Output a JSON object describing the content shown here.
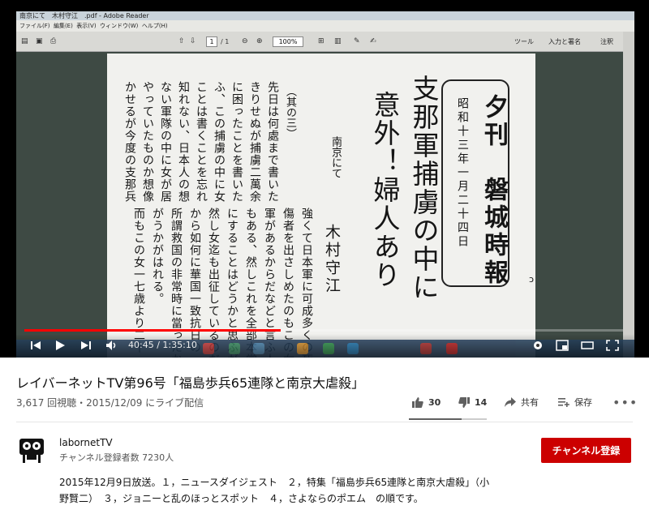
{
  "video": {
    "reader": {
      "window_title": "南京にて　木村守江　.pdf - Adobe Reader",
      "menu": [
        "ファイル(F)",
        "編集(E)",
        "表示(V)",
        "ウィンドウ(W)",
        "ヘルプ(H)"
      ],
      "page_current": "1",
      "page_total": "/ 1",
      "zoom": "100%",
      "tools_label": "ツール",
      "sign_label": "入力と署名",
      "comment_label": "注釈"
    },
    "document": {
      "masthead_title": "夕刊　磐城時報",
      "masthead_date": "昭和十三年一月二十四日",
      "headline_1": "支那軍捕虜の中に",
      "headline_2": "意外！婦人あり",
      "dateline": "南京にて",
      "author": "木村守江",
      "section_mark": "（其の三）",
      "body_right": [
        "先日は何處まで書いたかはっ",
        "きりせぬが捕虜二萬余の仕末",
        "に困ったことを書いたと思",
        "ふ、この捕虜の中に女が居た",
        "ことは書くことを忘れたかも",
        "知れない、日本人の想像出来",
        "ない軍隊の中に女が居る何を",
        "やっていたものか想像にま",
        "かせるが今度の支那兵が相當"
      ],
      "body_left": [
        "強くて日本軍に可成多くの死",
        "傷者を出さしめたのもこの女",
        "軍があるからだなどと言ふ人",
        "もある、然しこれを全部本當",
        "にすることはどうかと思ふが",
        "然し女迄も出征しているのだ",
        "から如何に華国一致抗日の",
        "所謂救国の非常時に當ったか",
        "がうかがはれる。",
        "而もこの女一七歳より二十"
      ]
    },
    "player": {
      "current_time": "40:45",
      "duration": "1:35:10",
      "progress_fraction": 0.428
    }
  },
  "info": {
    "title": "レイバーネットTV第96号「福島歩兵65連隊と南京大虐殺」",
    "views_date": "3,617 回視聴・2015/12/09 にライブ配信",
    "likes": "30",
    "dislikes": "14",
    "share_label": "共有",
    "save_label": "保存",
    "like_fraction": 0.68
  },
  "channel": {
    "name": "labornetTV",
    "subscribers": "チャンネル登録者数 7230人",
    "subscribe_label": "チャンネル登録"
  },
  "description": {
    "line_1": "2015年12月9日放送。１，ニュースダイジェスト　２，特集「福島歩兵65連隊と南京大虐殺」（小",
    "line_2": "野賢二）　３，ジョニーと乱のほっとスポット　４，さよならのポエム　の順です。"
  },
  "colors": {
    "accent_red": "#cc0000",
    "progress_red": "#ff0000"
  }
}
